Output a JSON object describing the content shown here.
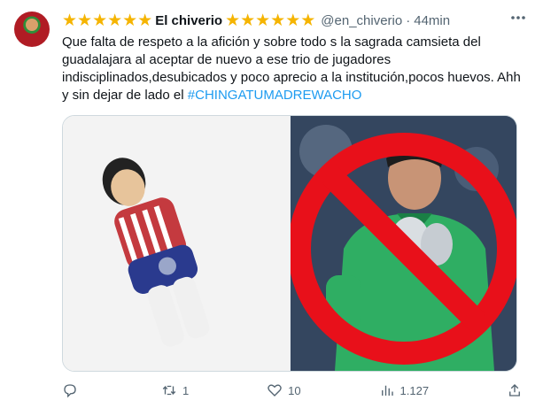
{
  "tweet": {
    "stars_left": "★★★★★★",
    "display_name": "El chiverio",
    "stars_right": "★★★★★★",
    "handle": "@en_chiverio",
    "separator": "·",
    "time": "44min",
    "more_icon": "more-icon",
    "text_main": "Que falta de respeto a la afición y sobre todo s la sagrada camsieta del guadalajara al aceptar de nuevo a ese trio de jugadores indisciplinados,desubicados y poco aprecio a la institución,pocos huevos. Ahh y sin dejar de lado el ",
    "hashtag": "#CHINGATUMADREWACHO"
  },
  "media": {
    "left_image": "foosball-figure-in-chivas-jersey",
    "right_image": "goalkeeper-in-green-with-red-prohibition-sign"
  },
  "actions": {
    "reply_count": "",
    "retweet_count": "1",
    "like_count": "10",
    "views_count": "1.127",
    "icons": [
      "reply-icon",
      "retweet-icon",
      "like-icon",
      "views-icon",
      "share-icon"
    ]
  },
  "colors": {
    "star": "#f5b400",
    "hashtag": "#1d9bf0",
    "muted": "#536471",
    "prohibition_red": "#e8101a"
  }
}
